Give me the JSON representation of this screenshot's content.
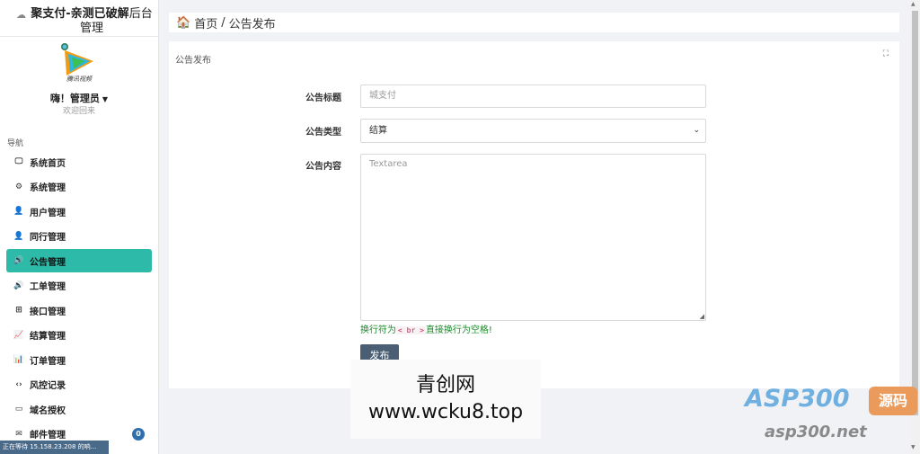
{
  "sidebar": {
    "title_bold": "聚支付-亲测已破解",
    "title_rest": "后台管理",
    "user_name": "嗨！管理员",
    "welcome": "欢迎回来",
    "avatar_text": "腾讯视频",
    "nav_heading": "导航",
    "items": [
      {
        "label": "系统首页",
        "icon": "monitor-icon",
        "glyph": "🖵"
      },
      {
        "label": "系统管理",
        "icon": "gears-icon",
        "glyph": "⚙"
      },
      {
        "label": "用户管理",
        "icon": "user-icon",
        "glyph": "👤"
      },
      {
        "label": "同行管理",
        "icon": "user-icon",
        "glyph": "👤"
      },
      {
        "label": "公告管理",
        "icon": "volume-icon",
        "glyph": "🔊"
      },
      {
        "label": "工单管理",
        "icon": "volume-icon",
        "glyph": "🔊"
      },
      {
        "label": "接口管理",
        "icon": "sitemap-icon",
        "glyph": "⊞"
      },
      {
        "label": "结算管理",
        "icon": "area-chart-icon",
        "glyph": "📈"
      },
      {
        "label": "订单管理",
        "icon": "bar-chart-icon",
        "glyph": "📊"
      },
      {
        "label": "风控记录",
        "icon": "code-icon",
        "glyph": "‹›"
      },
      {
        "label": "域名授权",
        "icon": "credit-card-icon",
        "glyph": "▭"
      },
      {
        "label": "邮件管理",
        "icon": "envelope-icon",
        "glyph": "✉",
        "badge": "0"
      }
    ],
    "active_index": 4
  },
  "status_text": "正在等待 15.158.23.208 的响...",
  "breadcrumb": {
    "home": "首页",
    "sep": "/",
    "current": "公告发布"
  },
  "panel": {
    "title": "公告发布",
    "form": {
      "title_label": "公告标题",
      "title_placeholder": "城支付",
      "type_label": "公告类型",
      "type_value": "结算",
      "content_label": "公告内容",
      "content_placeholder": "Textarea",
      "hint_before": "换行符为",
      "hint_code": "< br >",
      "hint_after": "直接换行为空格!",
      "submit_label": "发布"
    }
  },
  "watermark": {
    "line1": "青创网",
    "line2": "www.wcku8.top"
  },
  "logo": {
    "top": "ASP300",
    "box": "源码",
    "bottom": "asp300.net"
  },
  "colors": {
    "active": "#2ebaa9",
    "submit": "#4a5e74",
    "hint": "#1e8a2e"
  }
}
